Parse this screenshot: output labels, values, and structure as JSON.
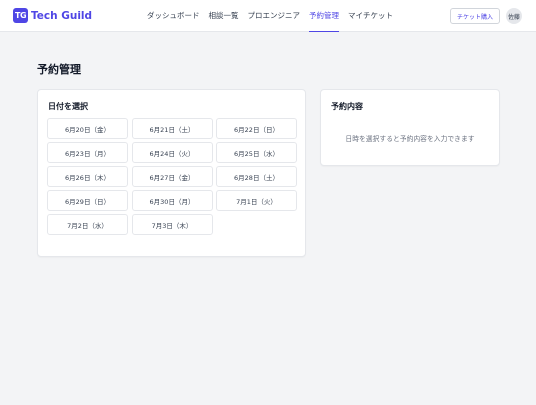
{
  "header": {
    "logo_mark": "TG",
    "logo_text": "Tech Guild",
    "nav": [
      {
        "label": "ダッシュボード",
        "active": false
      },
      {
        "label": "相談一覧",
        "active": false
      },
      {
        "label": "プロエンジニア",
        "active": false
      },
      {
        "label": "予約管理",
        "active": true
      },
      {
        "label": "マイチケット",
        "active": false
      }
    ],
    "ticket_button": "チケット購入",
    "avatar": "佐藤"
  },
  "page": {
    "title": "予約管理"
  },
  "date_card": {
    "title": "日付を選択",
    "dates": [
      "6月20日（金）",
      "6月21日（土）",
      "6月22日（日）",
      "6月23日（月）",
      "6月24日（火）",
      "6月25日（水）",
      "6月26日（木）",
      "6月27日（金）",
      "6月28日（土）",
      "6月29日（日）",
      "6月30日（月）",
      "7月1日（火）",
      "7月2日（水）",
      "7月3日（木）"
    ]
  },
  "detail_card": {
    "title": "予約内容",
    "placeholder": "日時を選択すると予約内容を入力できます"
  },
  "colors": {
    "accent": "#4f46e5",
    "background": "#f3f4f6",
    "card": "#ffffff"
  }
}
